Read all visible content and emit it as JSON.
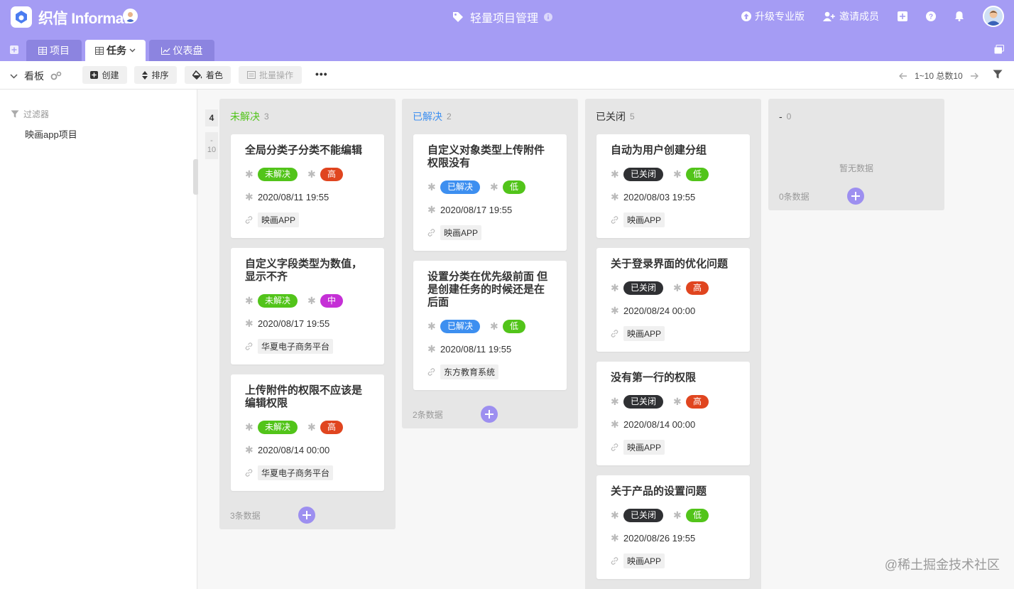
{
  "app": {
    "logo_text": "织信 Informat",
    "title": "轻量项目管理"
  },
  "header": {
    "upgrade_label": "升级专业版",
    "invite_label": "邀请成员"
  },
  "tabs": [
    {
      "label": "项目"
    },
    {
      "label": "任务"
    },
    {
      "label": "仪表盘"
    }
  ],
  "toolbar": {
    "view_label": "看板",
    "create_label": "创建",
    "sort_label": "排序",
    "color_label": "着色",
    "batch_label": "批量操作",
    "more_label": "•••",
    "pager_text": "1~10 总数10"
  },
  "sidebar": {
    "filter_label": "过滤器",
    "items": [
      {
        "label": "映画app项目"
      }
    ]
  },
  "group_nav": {
    "count": "4",
    "dash": "-",
    "total": "10"
  },
  "columns": [
    {
      "title": "未解决",
      "count": "3",
      "title_color": "#52c41a",
      "footer": "3条数据",
      "cards": [
        {
          "title": "全局分类子分类不能编辑",
          "status": "未解决",
          "priority": "高",
          "date": "2020/08/11 19:55",
          "ref": "映画APP"
        },
        {
          "title": "自定义字段类型为数值，显示不齐",
          "status": "未解决",
          "priority": "中",
          "date": "2020/08/17 19:55",
          "ref": "华夏电子商务平台"
        },
        {
          "title": "上传附件的权限不应该是编辑权限",
          "status": "未解决",
          "priority": "高",
          "date": "2020/08/14 00:00",
          "ref": "华夏电子商务平台"
        }
      ]
    },
    {
      "title": "已解决",
      "count": "2",
      "title_color": "#3d8ff0",
      "footer": "2条数据",
      "cards": [
        {
          "title": "自定义对象类型上传附件权限没有",
          "status": "已解决",
          "priority": "低",
          "date": "2020/08/17 19:55",
          "ref": "映画APP"
        },
        {
          "title": "设置分类在优先级前面 但是创建任务的时候还是在后面",
          "status": "已解决",
          "priority": "低",
          "date": "2020/08/11 19:55",
          "ref": "东方教育系统"
        }
      ]
    },
    {
      "title": "已关闭",
      "count": "5",
      "title_color": "#333333",
      "footer": "",
      "cards": [
        {
          "title": "自动为用户创建分组",
          "status": "已关闭",
          "priority": "低",
          "date": "2020/08/03 19:55",
          "ref": "映画APP"
        },
        {
          "title": "关于登录界面的优化问题",
          "status": "已关闭",
          "priority": "高",
          "date": "2020/08/24 00:00",
          "ref": "映画APP"
        },
        {
          "title": "没有第一行的权限",
          "status": "已关闭",
          "priority": "高",
          "date": "2020/08/14 00:00",
          "ref": "映画APP"
        },
        {
          "title": "关于产品的设置问题",
          "status": "已关闭",
          "priority": "低",
          "date": "2020/08/26 19:55",
          "ref": "映画APP"
        }
      ]
    },
    {
      "title": "-",
      "count": "0",
      "title_color": "#333333",
      "footer": "0条数据",
      "empty_text": "暂无数据",
      "cards": []
    }
  ],
  "colors": {
    "header_bg": "#a59cf4",
    "status_open": "#52c41a",
    "status_resolved": "#3d8ff0",
    "status_closed": "#2f3033",
    "priority_high": "#e0451f",
    "priority_mid": "#c530d6",
    "priority_low": "#52c41a"
  },
  "watermark": "@稀土掘金技术社区"
}
